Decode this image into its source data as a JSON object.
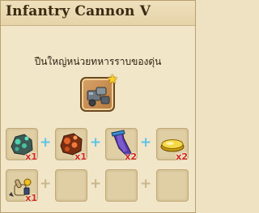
{
  "title": "Infantry Cannon V",
  "description": "ปืนใหญ่หน่วยทหารราบของดุ่น",
  "result": {
    "icon": "infantry-cannon-icon",
    "badge_icon": "star-icon"
  },
  "ingredients": [
    {
      "icon": "green-ore-icon",
      "quantity": "x1"
    },
    {
      "icon": "copper-ore-icon",
      "quantity": "x1"
    },
    {
      "icon": "purple-cloth-icon",
      "quantity": "x2"
    },
    {
      "icon": "gold-bar-icon",
      "quantity": "x2"
    },
    {
      "icon": "mortar-icon",
      "quantity": "x1"
    }
  ],
  "colors": {
    "panel_bg": "#f2e6c8",
    "quantity_text": "#d12a1a",
    "plus_active": "#5cc4e8",
    "star": "#ffd21f"
  }
}
